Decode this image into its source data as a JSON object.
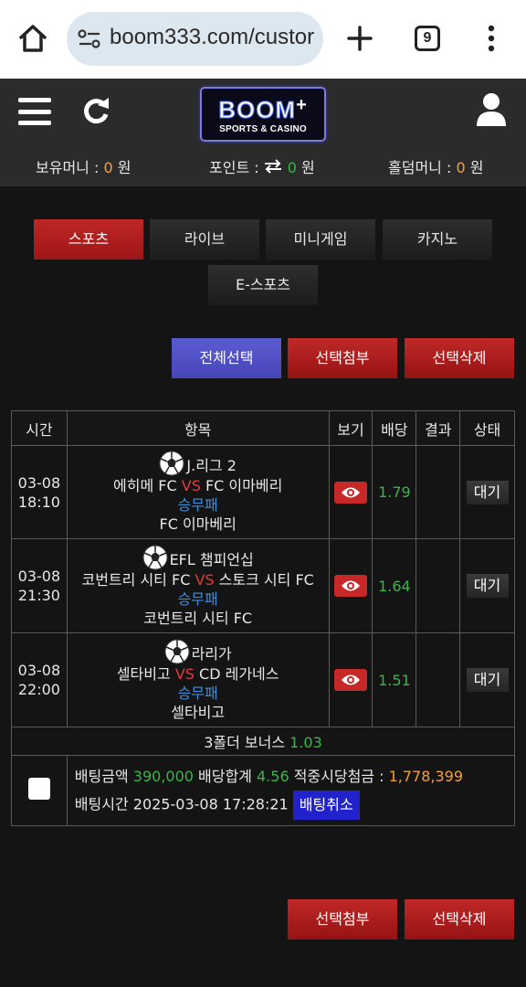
{
  "browser": {
    "url": "boom333.com/custor",
    "tab_count": "9"
  },
  "header": {
    "logo_main": "BOOM",
    "logo_plus": "+",
    "logo_sub": "SPORTS & CASINO",
    "balances": [
      {
        "label": "보유머니 : ",
        "value": "0",
        "unit": " 원"
      },
      {
        "label": "포인트 : ",
        "value": "0",
        "unit": " 원"
      },
      {
        "label": "홀덤머니 : ",
        "value": "0",
        "unit": " 원"
      }
    ]
  },
  "tabs": [
    {
      "label": "스포츠",
      "active": true
    },
    {
      "label": "라이브",
      "active": false
    },
    {
      "label": "미니게임",
      "active": false
    },
    {
      "label": "카지노",
      "active": false
    },
    {
      "label": "E-스포츠",
      "active": false
    }
  ],
  "actions": {
    "select_all": "전체선택",
    "attach_selected": "선택첨부",
    "delete_selected": "선택삭제"
  },
  "table": {
    "headers": [
      "시간",
      "항목",
      "보기",
      "배당",
      "결과",
      "상태"
    ],
    "rows": [
      {
        "date": "03-08",
        "time": "18:10",
        "league": "J.리그 2",
        "home": "에히메 FC",
        "vs": "VS",
        "away": "FC 이마베리",
        "market": "승무패",
        "pick": "FC 이마베리",
        "odds": "1.79",
        "status": "대기"
      },
      {
        "date": "03-08",
        "time": "21:30",
        "league": "EFL 챔피언십",
        "home": "코번트리 시티 FC",
        "vs": "VS",
        "away": "스토크 시티 FC",
        "market": "승무패",
        "pick": "코번트리 시티 FC",
        "odds": "1.64",
        "status": "대기"
      },
      {
        "date": "03-08",
        "time": "22:00",
        "league": "라리가",
        "home": "셀타비고",
        "vs": "VS",
        "away": "CD 레가네스",
        "market": "승무패",
        "pick": "셀타비고",
        "odds": "1.51",
        "status": "대기"
      }
    ],
    "bonus_label": "3폴더 보너스 ",
    "bonus_value": "1.03"
  },
  "slip": {
    "amount_label": "배팅금액 ",
    "amount": "390,000",
    "total_label": " 배당합계 ",
    "total": "4.56",
    "payout_label": " 적중시당첨금 : ",
    "payout": "1,778,399",
    "time_label": "배팅시간 ",
    "time": "2025-03-08 17:28:21",
    "cancel": "배팅취소"
  },
  "colors": {
    "accent_red": "#c02626",
    "select_blue": "#5252c8",
    "odds_green": "#3bb54a",
    "money_orange": "#f0a040",
    "market_blue": "#3f8fdc"
  }
}
